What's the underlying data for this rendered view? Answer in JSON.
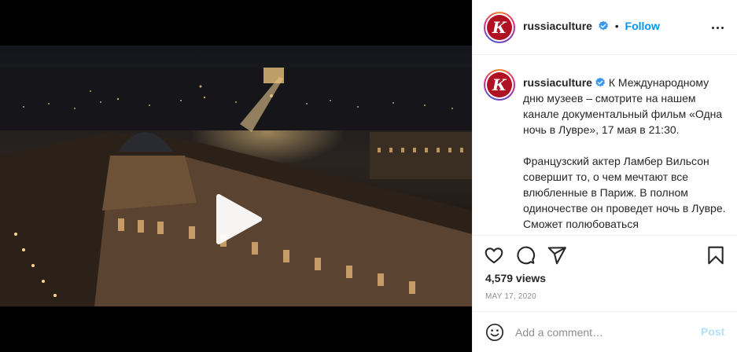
{
  "post": {
    "username": "russiaculture",
    "avatar_letter": "К",
    "follow_label": "Follow",
    "separator": "•",
    "caption_paragraphs": [
      "К Международному дню музеев – смотрите на нашем канале документальный фильм «Одна ночь в Лувре», 17 мая в 21:30.",
      "Французский актер Ламбер Вильсон совершит то, о чем мечтают все влюбленные в Париж. В полном одиночестве он проведет ночь в Лувре. Сможет полюбоваться"
    ],
    "views": "4,579 views",
    "date": "MAY 17, 2020"
  },
  "comment": {
    "placeholder": "Add a comment…",
    "post_label": "Post"
  },
  "icons": {
    "verified": "verified-badge-icon",
    "more": "more-options-icon",
    "like": "heart-icon",
    "comment": "comment-icon",
    "share": "share-icon",
    "save": "bookmark-icon",
    "emoji": "emoji-icon",
    "play": "play-icon",
    "mute": "muted-speaker-icon"
  },
  "colors": {
    "accent": "#0095f6",
    "post_disabled": "#b2dffc",
    "verified": "#3897f0",
    "avatar_bg": "#b01224"
  }
}
